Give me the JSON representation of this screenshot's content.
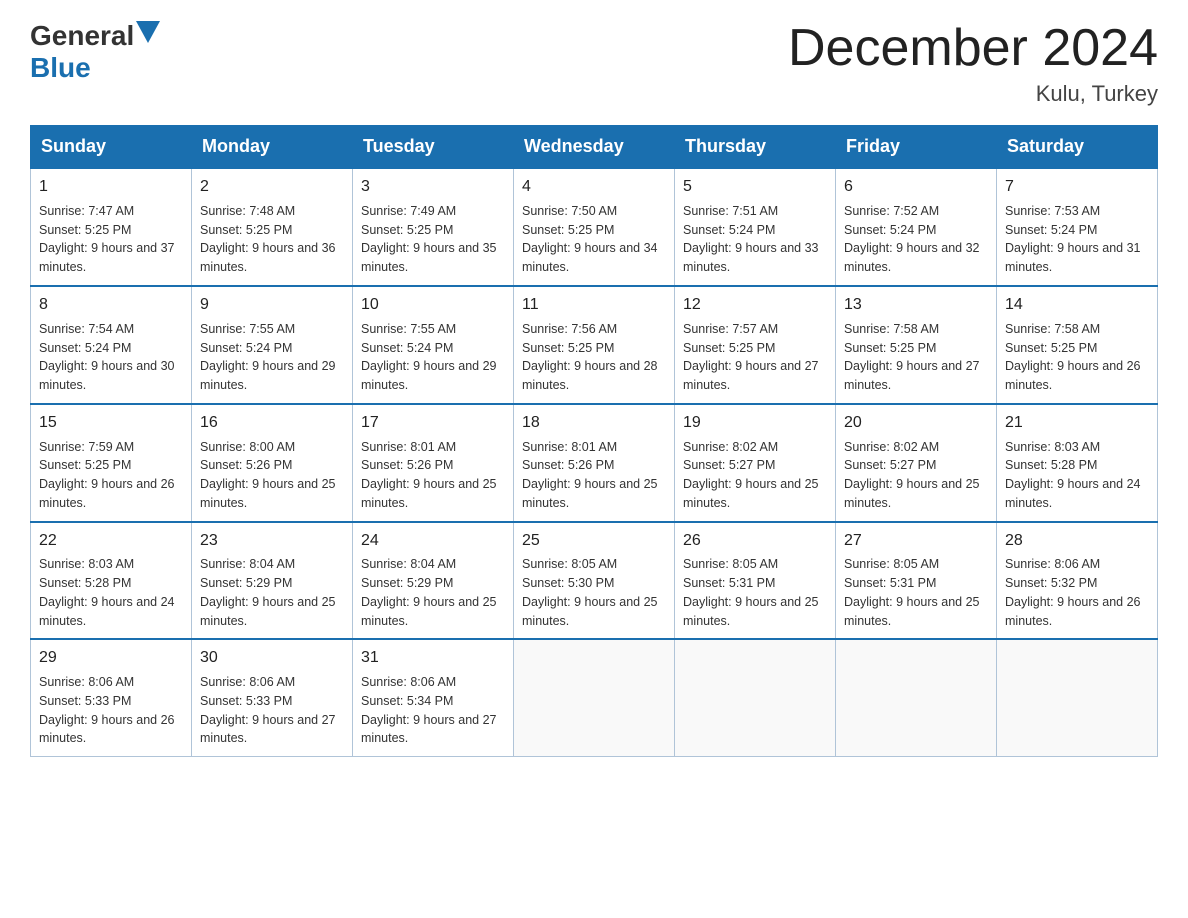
{
  "header": {
    "logo_general": "General",
    "logo_blue": "Blue",
    "month_title": "December 2024",
    "location": "Kulu, Turkey"
  },
  "days_of_week": [
    "Sunday",
    "Monday",
    "Tuesday",
    "Wednesday",
    "Thursday",
    "Friday",
    "Saturday"
  ],
  "weeks": [
    [
      {
        "day": "1",
        "sunrise": "Sunrise: 7:47 AM",
        "sunset": "Sunset: 5:25 PM",
        "daylight": "Daylight: 9 hours and 37 minutes."
      },
      {
        "day": "2",
        "sunrise": "Sunrise: 7:48 AM",
        "sunset": "Sunset: 5:25 PM",
        "daylight": "Daylight: 9 hours and 36 minutes."
      },
      {
        "day": "3",
        "sunrise": "Sunrise: 7:49 AM",
        "sunset": "Sunset: 5:25 PM",
        "daylight": "Daylight: 9 hours and 35 minutes."
      },
      {
        "day": "4",
        "sunrise": "Sunrise: 7:50 AM",
        "sunset": "Sunset: 5:25 PM",
        "daylight": "Daylight: 9 hours and 34 minutes."
      },
      {
        "day": "5",
        "sunrise": "Sunrise: 7:51 AM",
        "sunset": "Sunset: 5:24 PM",
        "daylight": "Daylight: 9 hours and 33 minutes."
      },
      {
        "day": "6",
        "sunrise": "Sunrise: 7:52 AM",
        "sunset": "Sunset: 5:24 PM",
        "daylight": "Daylight: 9 hours and 32 minutes."
      },
      {
        "day": "7",
        "sunrise": "Sunrise: 7:53 AM",
        "sunset": "Sunset: 5:24 PM",
        "daylight": "Daylight: 9 hours and 31 minutes."
      }
    ],
    [
      {
        "day": "8",
        "sunrise": "Sunrise: 7:54 AM",
        "sunset": "Sunset: 5:24 PM",
        "daylight": "Daylight: 9 hours and 30 minutes."
      },
      {
        "day": "9",
        "sunrise": "Sunrise: 7:55 AM",
        "sunset": "Sunset: 5:24 PM",
        "daylight": "Daylight: 9 hours and 29 minutes."
      },
      {
        "day": "10",
        "sunrise": "Sunrise: 7:55 AM",
        "sunset": "Sunset: 5:24 PM",
        "daylight": "Daylight: 9 hours and 29 minutes."
      },
      {
        "day": "11",
        "sunrise": "Sunrise: 7:56 AM",
        "sunset": "Sunset: 5:25 PM",
        "daylight": "Daylight: 9 hours and 28 minutes."
      },
      {
        "day": "12",
        "sunrise": "Sunrise: 7:57 AM",
        "sunset": "Sunset: 5:25 PM",
        "daylight": "Daylight: 9 hours and 27 minutes."
      },
      {
        "day": "13",
        "sunrise": "Sunrise: 7:58 AM",
        "sunset": "Sunset: 5:25 PM",
        "daylight": "Daylight: 9 hours and 27 minutes."
      },
      {
        "day": "14",
        "sunrise": "Sunrise: 7:58 AM",
        "sunset": "Sunset: 5:25 PM",
        "daylight": "Daylight: 9 hours and 26 minutes."
      }
    ],
    [
      {
        "day": "15",
        "sunrise": "Sunrise: 7:59 AM",
        "sunset": "Sunset: 5:25 PM",
        "daylight": "Daylight: 9 hours and 26 minutes."
      },
      {
        "day": "16",
        "sunrise": "Sunrise: 8:00 AM",
        "sunset": "Sunset: 5:26 PM",
        "daylight": "Daylight: 9 hours and 25 minutes."
      },
      {
        "day": "17",
        "sunrise": "Sunrise: 8:01 AM",
        "sunset": "Sunset: 5:26 PM",
        "daylight": "Daylight: 9 hours and 25 minutes."
      },
      {
        "day": "18",
        "sunrise": "Sunrise: 8:01 AM",
        "sunset": "Sunset: 5:26 PM",
        "daylight": "Daylight: 9 hours and 25 minutes."
      },
      {
        "day": "19",
        "sunrise": "Sunrise: 8:02 AM",
        "sunset": "Sunset: 5:27 PM",
        "daylight": "Daylight: 9 hours and 25 minutes."
      },
      {
        "day": "20",
        "sunrise": "Sunrise: 8:02 AM",
        "sunset": "Sunset: 5:27 PM",
        "daylight": "Daylight: 9 hours and 25 minutes."
      },
      {
        "day": "21",
        "sunrise": "Sunrise: 8:03 AM",
        "sunset": "Sunset: 5:28 PM",
        "daylight": "Daylight: 9 hours and 24 minutes."
      }
    ],
    [
      {
        "day": "22",
        "sunrise": "Sunrise: 8:03 AM",
        "sunset": "Sunset: 5:28 PM",
        "daylight": "Daylight: 9 hours and 24 minutes."
      },
      {
        "day": "23",
        "sunrise": "Sunrise: 8:04 AM",
        "sunset": "Sunset: 5:29 PM",
        "daylight": "Daylight: 9 hours and 25 minutes."
      },
      {
        "day": "24",
        "sunrise": "Sunrise: 8:04 AM",
        "sunset": "Sunset: 5:29 PM",
        "daylight": "Daylight: 9 hours and 25 minutes."
      },
      {
        "day": "25",
        "sunrise": "Sunrise: 8:05 AM",
        "sunset": "Sunset: 5:30 PM",
        "daylight": "Daylight: 9 hours and 25 minutes."
      },
      {
        "day": "26",
        "sunrise": "Sunrise: 8:05 AM",
        "sunset": "Sunset: 5:31 PM",
        "daylight": "Daylight: 9 hours and 25 minutes."
      },
      {
        "day": "27",
        "sunrise": "Sunrise: 8:05 AM",
        "sunset": "Sunset: 5:31 PM",
        "daylight": "Daylight: 9 hours and 25 minutes."
      },
      {
        "day": "28",
        "sunrise": "Sunrise: 8:06 AM",
        "sunset": "Sunset: 5:32 PM",
        "daylight": "Daylight: 9 hours and 26 minutes."
      }
    ],
    [
      {
        "day": "29",
        "sunrise": "Sunrise: 8:06 AM",
        "sunset": "Sunset: 5:33 PM",
        "daylight": "Daylight: 9 hours and 26 minutes."
      },
      {
        "day": "30",
        "sunrise": "Sunrise: 8:06 AM",
        "sunset": "Sunset: 5:33 PM",
        "daylight": "Daylight: 9 hours and 27 minutes."
      },
      {
        "day": "31",
        "sunrise": "Sunrise: 8:06 AM",
        "sunset": "Sunset: 5:34 PM",
        "daylight": "Daylight: 9 hours and 27 minutes."
      },
      null,
      null,
      null,
      null
    ]
  ]
}
